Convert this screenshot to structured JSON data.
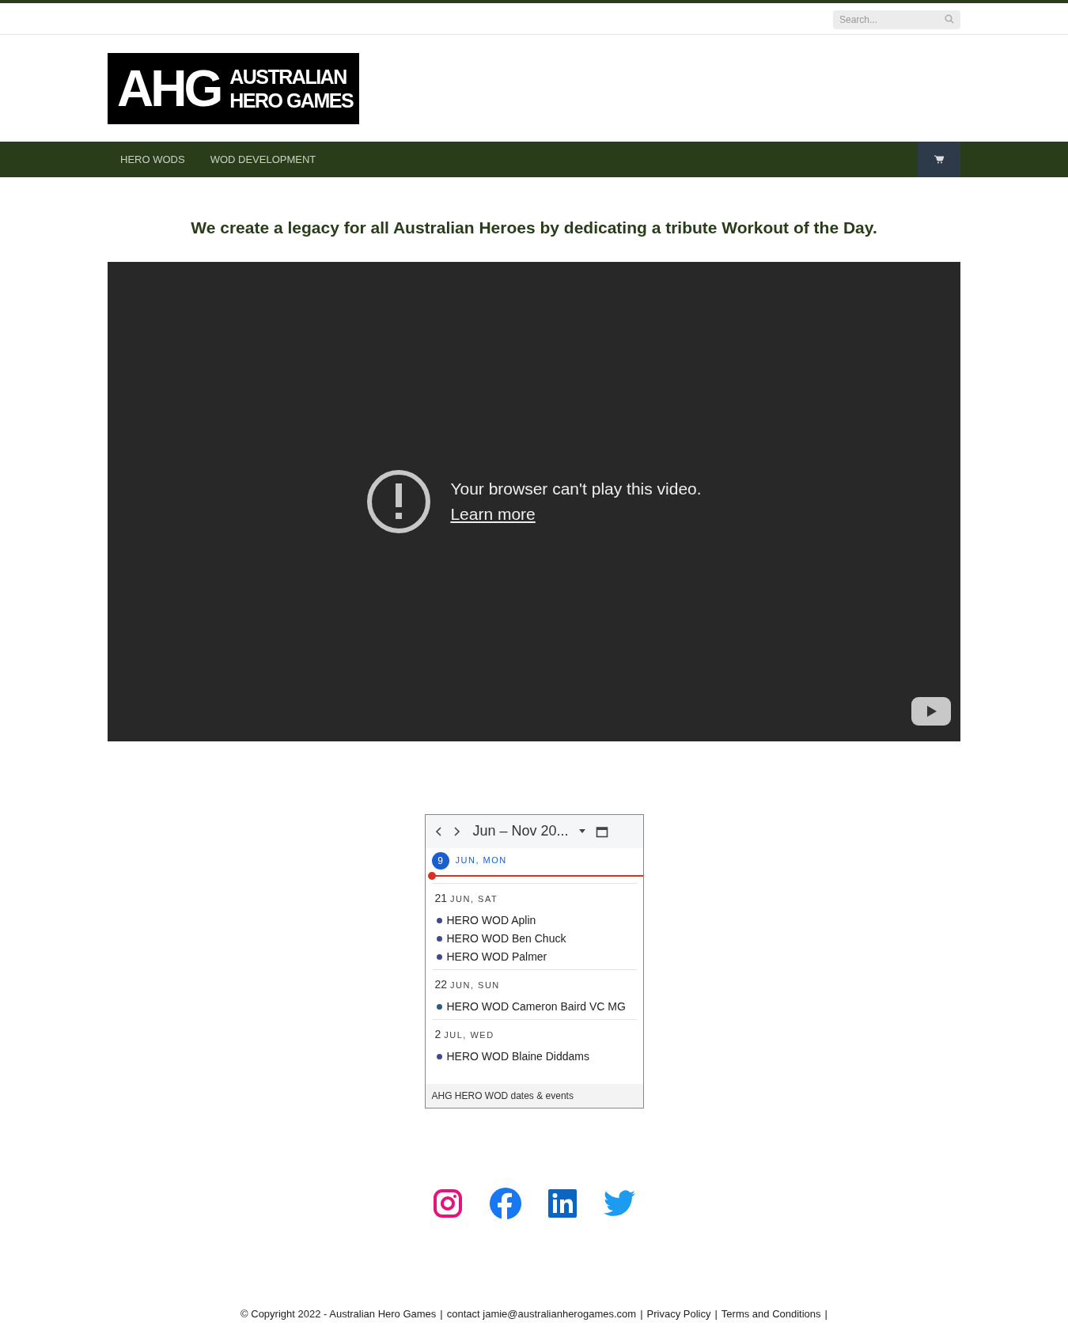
{
  "search": {
    "placeholder": "Search..."
  },
  "logo": {
    "mark": "AHG",
    "line_1": "AUSTRALIAN",
    "line_2": "HERO GAMES"
  },
  "nav": {
    "items": [
      {
        "label": "HERO WODS"
      },
      {
        "label": "WOD DEVELOPMENT"
      }
    ]
  },
  "tagline": "We create a legacy for all Australian Heroes by dedicating a tribute Workout of the Day.",
  "video": {
    "message": "Your browser can't play this video.",
    "link": "Learn more"
  },
  "calendar": {
    "range": "Jun – Nov 20...",
    "today": {
      "day": "9",
      "label": "JUN, MON"
    },
    "days": [
      {
        "day": "21",
        "label": "JUN, SAT",
        "events": [
          {
            "title": "HERO WOD Aplin",
            "color": "#3f4a8a"
          },
          {
            "title": "HERO WOD Ben Chuck",
            "color": "#3f4a8a"
          },
          {
            "title": "HERO WOD Palmer",
            "color": "#3f4a8a"
          }
        ]
      },
      {
        "day": "22",
        "label": "JUN, SUN",
        "events": [
          {
            "title": "HERO WOD Cameron Baird VC MG",
            "color": "#2f5b7c"
          }
        ]
      },
      {
        "day": "2",
        "label": "JUL, WED",
        "events": [
          {
            "title": "HERO WOD Blaine Diddams",
            "color": "#3f4a8a"
          }
        ]
      }
    ],
    "footer": "AHG HERO WOD dates & events"
  },
  "social": [
    {
      "kind": "instagram"
    },
    {
      "kind": "facebook"
    },
    {
      "kind": "linkedin"
    },
    {
      "kind": "twitter"
    }
  ],
  "footer": {
    "copyright": "© Copyright 2022 - Australian Hero Games",
    "sep_1": "|",
    "contact": "contact jamie@australianherogames.com",
    "sep_2": "|",
    "privacy": "Privacy Policy",
    "sep_3": "|",
    "terms": "Terms and Conditions",
    "sep_4": "|"
  }
}
